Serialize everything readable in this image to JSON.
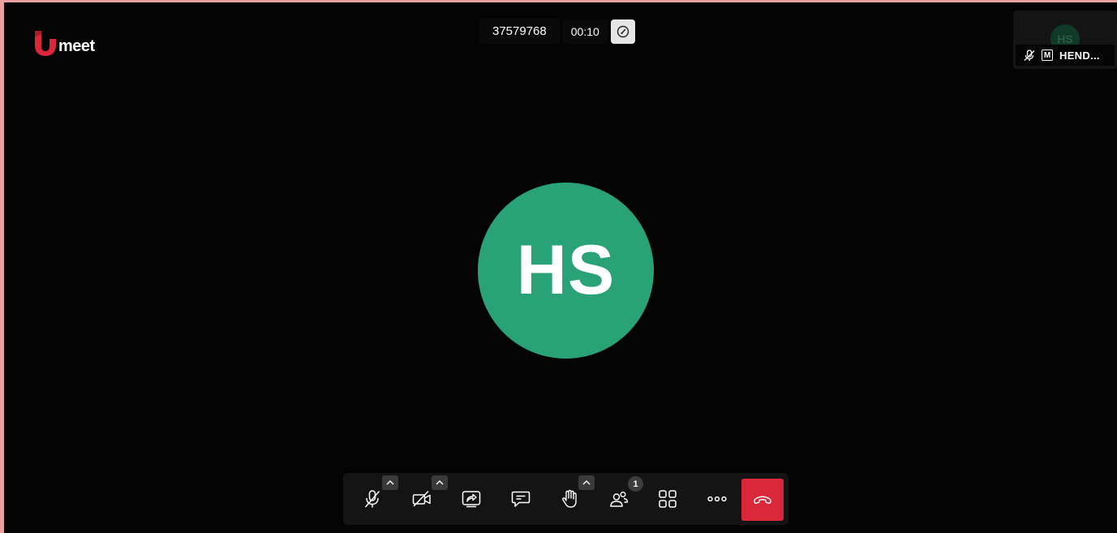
{
  "app": {
    "logo_text": "meet",
    "brand_color": "#d8283a"
  },
  "meeting": {
    "id": "37579768",
    "duration": "00:10"
  },
  "main_participant": {
    "initials": "HS",
    "avatar_color": "#2aa277"
  },
  "thumbnail": {
    "initials": "HS",
    "moderator_badge": "M",
    "name": "HEND...",
    "mic_icon": "mic-off-icon"
  },
  "toolbar": {
    "participants_count": "1",
    "buttons": [
      {
        "name": "microphone",
        "icon": "mic-off-icon"
      },
      {
        "name": "camera",
        "icon": "camera-off-icon"
      },
      {
        "name": "share-screen",
        "icon": "share-screen-icon"
      },
      {
        "name": "chat",
        "icon": "chat-icon"
      },
      {
        "name": "raise-hand",
        "icon": "hand-icon"
      },
      {
        "name": "participants",
        "icon": "participants-icon"
      },
      {
        "name": "tile-view",
        "icon": "grid-icon"
      },
      {
        "name": "more",
        "icon": "more-icon"
      },
      {
        "name": "hangup",
        "icon": "phone-hangup-icon"
      }
    ]
  }
}
